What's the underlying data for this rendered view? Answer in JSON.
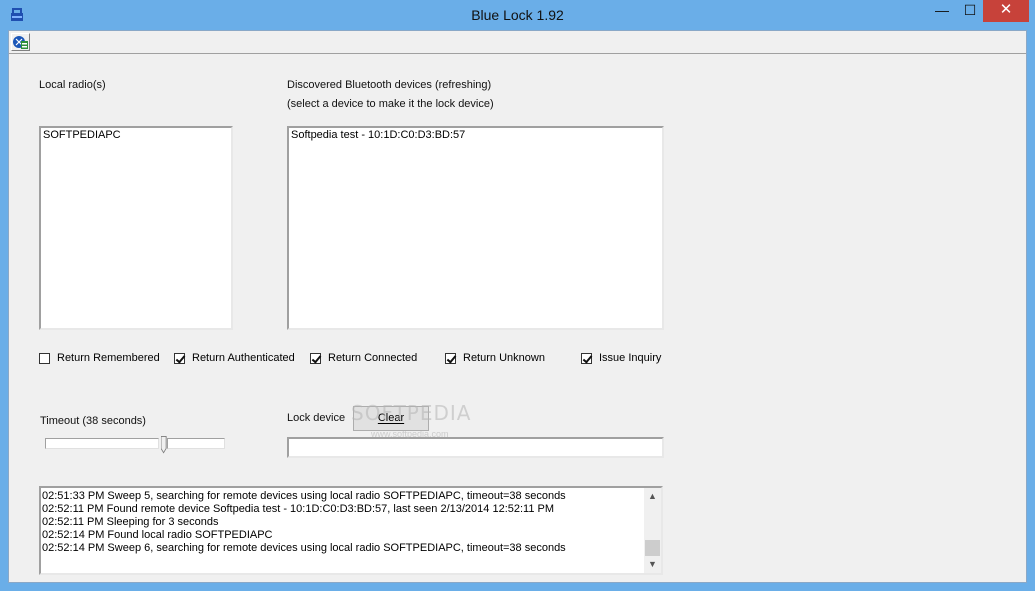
{
  "window": {
    "title": "Blue Lock 1.92",
    "minimize_glyph": "—",
    "maximize_glyph": "☐",
    "close_glyph": "✕"
  },
  "toolbar": {
    "icon": "bluetooth-settings-icon"
  },
  "local_radios": {
    "label": "Local radio(s)",
    "items": [
      "SOFTPEDIAPC"
    ]
  },
  "discovered": {
    "label_line1": "Discovered Bluetooth devices (refreshing)",
    "label_line2": "(select a device to make it the lock device)",
    "items": [
      "Softpedia test - 10:1D:C0:D3:BD:57"
    ]
  },
  "options": [
    {
      "label": "Return Remembered",
      "checked": false
    },
    {
      "label": "Return Authenticated",
      "checked": true
    },
    {
      "label": "Return Connected",
      "checked": true
    },
    {
      "label": "Return Unknown",
      "checked": true
    },
    {
      "label": "Issue Inquiry",
      "checked": true
    }
  ],
  "timeout": {
    "label": "Timeout (38 seconds)",
    "seconds": 38
  },
  "lock_device": {
    "label": "Lock device",
    "clear_label": "Clear",
    "value": ""
  },
  "log": {
    "lines": [
      "02:51:33 PM Sweep 5, searching for remote devices using local radio SOFTPEDIAPC, timeout=38 seconds",
      "02:52:11 PM Found remote device Softpedia test - 10:1D:C0:D3:BD:57, last seen 2/13/2014 12:52:11 PM",
      "02:52:11 PM Sleeping for 3 seconds",
      "02:52:14 PM Found local radio SOFTPEDIAPC",
      "02:52:14 PM Sweep 6, searching for remote devices using local radio SOFTPEDIAPC, timeout=38 seconds"
    ]
  },
  "watermark": {
    "text": "SOFTPEDIA",
    "sub": "www.softpedia.com"
  },
  "colors": {
    "titlebar": "#6aaee8",
    "close": "#c7423a",
    "client": "#f0f0f0"
  }
}
